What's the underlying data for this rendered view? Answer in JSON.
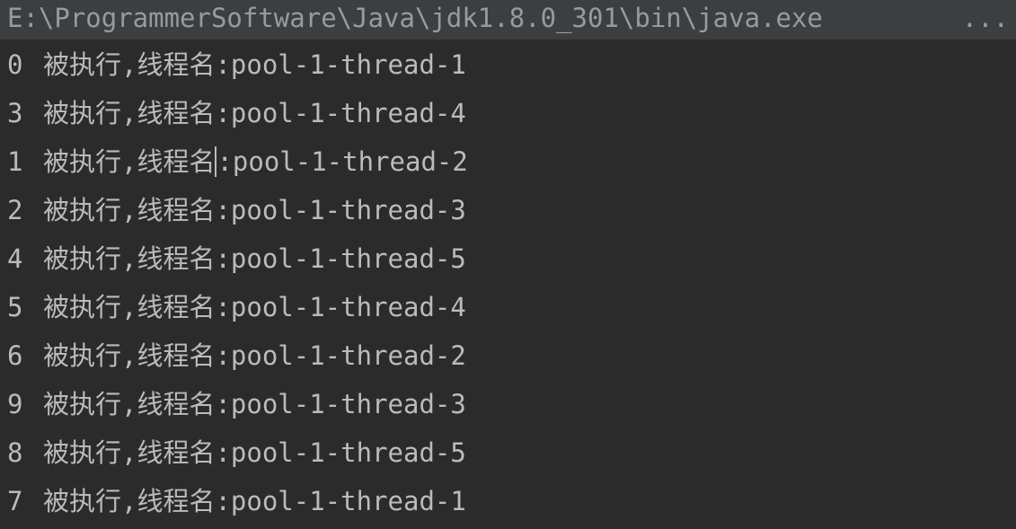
{
  "command": {
    "path": "E:\\ProgrammerSoftware\\Java\\jdk1.8.0_301\\bin\\java.exe",
    "ellipsis": "..."
  },
  "output_lines": [
    {
      "index": "0",
      "prefix": "被执行,线程名",
      "suffix": ":pool-1-thread-1"
    },
    {
      "index": "3",
      "prefix": "被执行,线程名",
      "suffix": ":pool-1-thread-4"
    },
    {
      "index": "1",
      "prefix": "被执行,线程名",
      "suffix": ":pool-1-thread-2"
    },
    {
      "index": "2",
      "prefix": "被执行,线程名",
      "suffix": ":pool-1-thread-3"
    },
    {
      "index": "4",
      "prefix": "被执行,线程名",
      "suffix": ":pool-1-thread-5"
    },
    {
      "index": "5",
      "prefix": "被执行,线程名",
      "suffix": ":pool-1-thread-4"
    },
    {
      "index": "6",
      "prefix": "被执行,线程名",
      "suffix": ":pool-1-thread-2"
    },
    {
      "index": "9",
      "prefix": "被执行,线程名",
      "suffix": ":pool-1-thread-3"
    },
    {
      "index": "8",
      "prefix": "被执行,线程名",
      "suffix": ":pool-1-thread-5"
    },
    {
      "index": "7",
      "prefix": "被执行,线程名",
      "suffix": ":pool-1-thread-1"
    }
  ],
  "colors": {
    "background": "#2b2b2b",
    "command_bar": "#3c3f41",
    "text": "#bbbbbb",
    "command_text": "#9a9a9a"
  },
  "cursor_line_index": 2
}
